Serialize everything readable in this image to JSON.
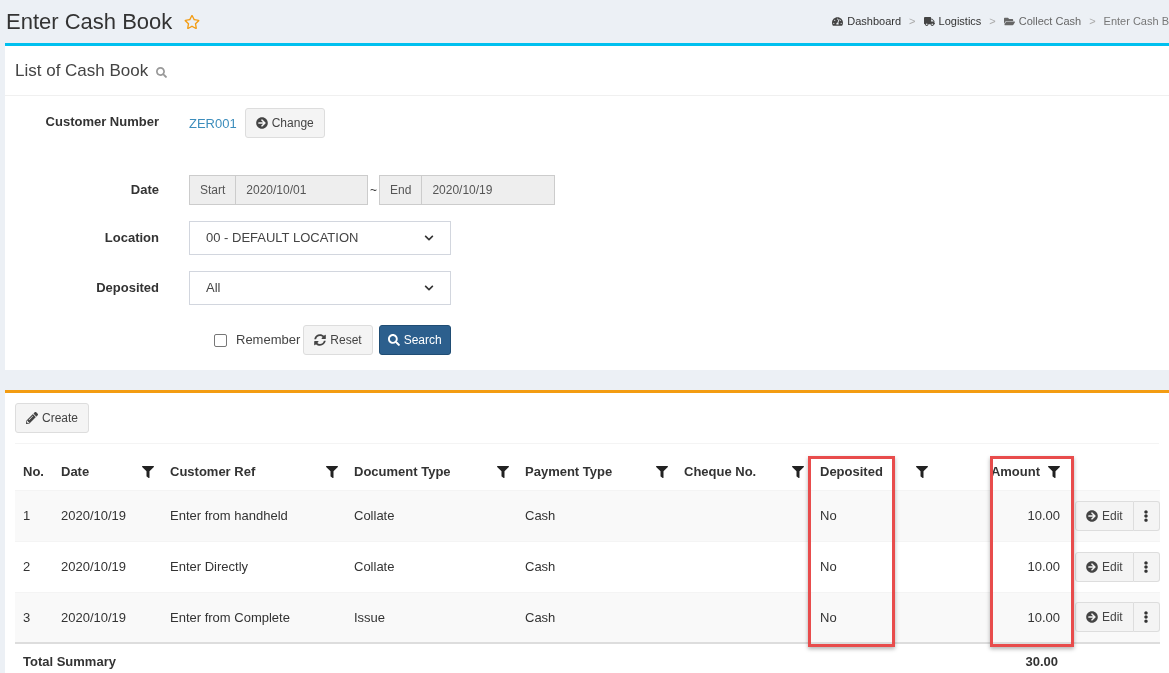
{
  "page": {
    "title": "Enter Cash Book",
    "favorite": false
  },
  "breadcrumb": {
    "separator": ">",
    "items": [
      {
        "label": "Dashboard",
        "kind": "dashboard"
      },
      {
        "label": "Logistics",
        "kind": "truck"
      },
      {
        "label": "Collect Cash",
        "kind": "folder"
      },
      {
        "label": "Enter Cash B",
        "kind": "current"
      }
    ]
  },
  "search_panel": {
    "title": "List of Cash Book",
    "customer_number": {
      "label": "Customer Number",
      "value": "ZER001",
      "button": "Change"
    },
    "date": {
      "label": "Date",
      "start_label": "Start",
      "start": "2020/10/01",
      "separator": "~",
      "end_label": "End",
      "end": "2020/10/19"
    },
    "location": {
      "label": "Location",
      "value": "00 - DEFAULT LOCATION"
    },
    "deposited": {
      "label": "Deposited",
      "value": "All"
    },
    "remember": {
      "label": "Remember",
      "checked": false
    },
    "reset_button": "Reset",
    "search_button": "Search"
  },
  "list_panel": {
    "create_button": "Create",
    "table": {
      "columns": [
        {
          "label": "No.",
          "filter": false,
          "highlighted": false,
          "kind": "text"
        },
        {
          "label": "Date",
          "filter": true,
          "highlighted": false,
          "kind": "text"
        },
        {
          "label": "Customer Ref",
          "filter": true,
          "highlighted": false,
          "kind": "text"
        },
        {
          "label": "Document Type",
          "filter": true,
          "highlighted": false,
          "kind": "text"
        },
        {
          "label": "Payment Type",
          "filter": true,
          "highlighted": false,
          "kind": "text"
        },
        {
          "label": "Cheque No.",
          "filter": true,
          "highlighted": false,
          "kind": "text"
        },
        {
          "label": "Deposited",
          "filter": true,
          "highlighted": true,
          "kind": "text"
        },
        {
          "label": "Amount",
          "filter": true,
          "highlighted": true,
          "kind": "amount"
        }
      ],
      "rows": [
        {
          "cells": [
            "1",
            "2020/10/19",
            "Enter from handheld",
            "Collate",
            "Cash",
            "",
            "No",
            "10.00"
          ],
          "edit": "Edit"
        },
        {
          "cells": [
            "2",
            "2020/10/19",
            "Enter Directly",
            "Collate",
            "Cash",
            "",
            "No",
            "10.00"
          ],
          "edit": "Edit"
        },
        {
          "cells": [
            "3",
            "2020/10/19",
            "Enter from Complete",
            "Issue",
            "Cash",
            "",
            "No",
            "10.00"
          ],
          "edit": "Edit"
        }
      ],
      "summary": {
        "label": "Total Summary",
        "amount": "30.00"
      }
    }
  }
}
